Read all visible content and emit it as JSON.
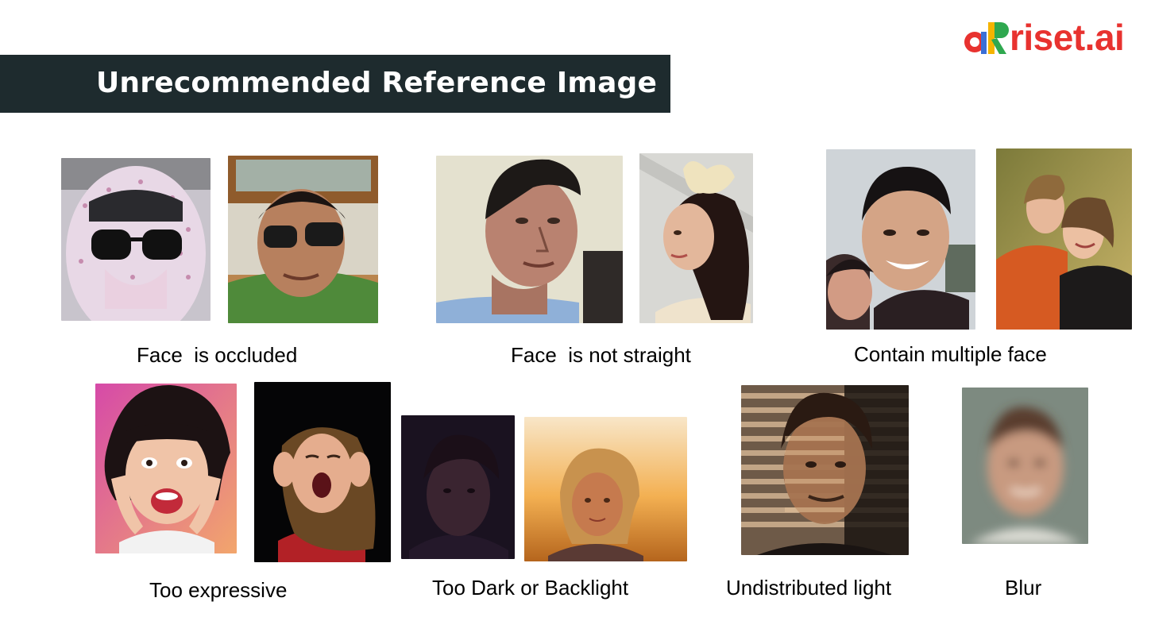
{
  "logo": {
    "text": "riset.ai",
    "mark_letters": "aR"
  },
  "title": "Unrecommended Reference Image",
  "captions": {
    "occluded": "Face  is occluded",
    "not_straight": "Face  is not straight",
    "multiple": "Contain multiple face",
    "expressive": "Too expressive",
    "dark": "Too Dark or Backlight",
    "undistributed": "Undistributed light",
    "blur": "Blur"
  },
  "colors": {
    "title_bar": "#1e2b2e",
    "title_text": "#ffffff",
    "logo_red": "#e8322f",
    "logo_blue": "#3b6fd6",
    "logo_yellow": "#f5b400",
    "logo_green": "#2fa84f"
  }
}
